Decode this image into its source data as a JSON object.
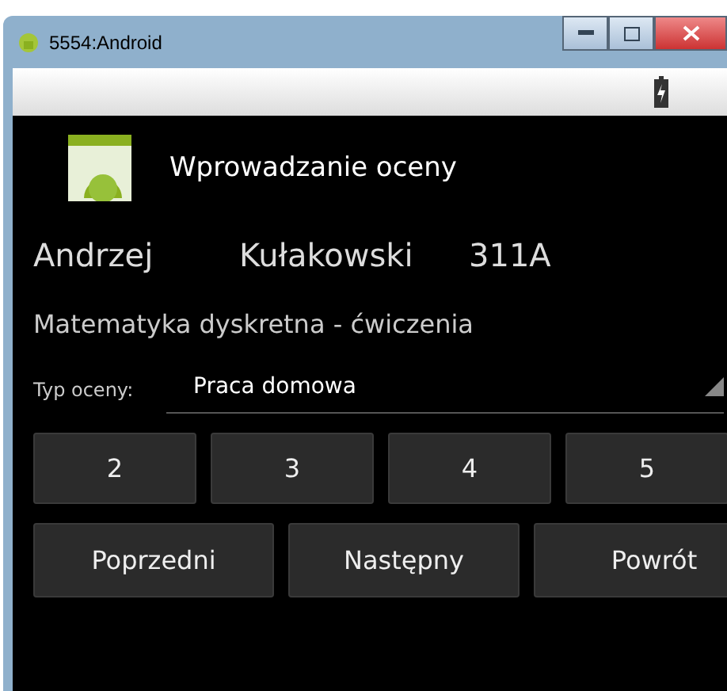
{
  "window": {
    "title": "5554:Android"
  },
  "app": {
    "title": "Wprowadzanie oceny"
  },
  "student": {
    "first_name": "Andrzej",
    "last_name": "Kułakowski",
    "group": "311A"
  },
  "subject": "Matematyka dyskretna - ćwiczenia",
  "grade_type": {
    "label": "Typ oceny:",
    "value": "Praca domowa"
  },
  "grades": [
    "2",
    "3",
    "4",
    "5"
  ],
  "nav_buttons": [
    "Poprzedni",
    "Następny",
    "Powrót"
  ]
}
